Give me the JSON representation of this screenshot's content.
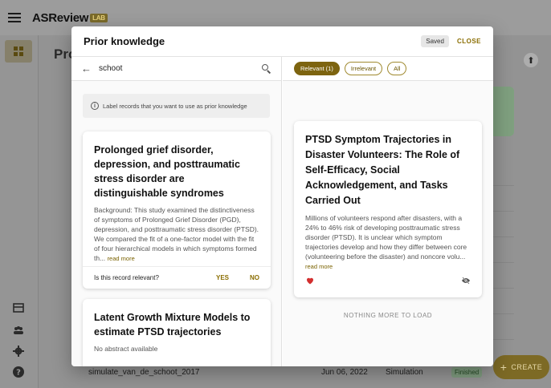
{
  "app": {
    "brand": "ASReview",
    "brand_tag": "LAB"
  },
  "background": {
    "page_title": "Pro",
    "row": {
      "name": "simulate_van_de_schoot_2017",
      "date": "Jun 06, 2022",
      "mode": "Simulation",
      "status": "Finished"
    },
    "fab_label": "CREATE"
  },
  "dialog": {
    "title": "Prior knowledge",
    "saved_label": "Saved",
    "close_label": "CLOSE",
    "search": {
      "query": "schoot"
    },
    "info_text": "Label records that you want to use as prior knowledge",
    "results": [
      {
        "title": "Prolonged grief disorder, depression, and posttraumatic stress disorder are distinguishable syndromes",
        "abstract": "Background: This study examined the distinctiveness of symptoms of Prolonged Grief Disorder (PGD), depression, and posttraumatic stress disorder (PTSD). We compared the fit of a one-factor model with the fit of four hierarchical models in which symptoms formed th...",
        "read_more": "read more",
        "question": "Is this record relevant?",
        "yes_label": "YES",
        "no_label": "NO"
      },
      {
        "title": "Latent Growth Mixture Models to estimate PTSD trajectories",
        "abstract": "No abstract available"
      }
    ],
    "filters": [
      {
        "label": "Relevant (1)",
        "active": true
      },
      {
        "label": "Irrelevant",
        "active": false
      },
      {
        "label": "All",
        "active": false
      }
    ],
    "labeled": {
      "title": "PTSD Symptom Trajectories in Disaster Volunteers: The Role of Self-Efficacy, Social Acknowledgement, and Tasks Carried Out",
      "abstract": "Millions of volunteers respond after disasters, with a 24% to 46% risk of developing posttraumatic stress disorder (PTSD). It is unclear which symptom trajectories develop and how they differ between core (volunteering before the disaster) and noncore volu...",
      "read_more": "read more"
    },
    "nothing_more": "NOTHING MORE TO LOAD"
  },
  "icons": {
    "menu": "menu-icon",
    "dashboard": "dashboard-icon",
    "search": "search-icon",
    "back": "back-arrow-icon",
    "info": "info-icon",
    "heart": "heart-icon",
    "hide": "visibility-off-icon",
    "upload": "upload-icon"
  },
  "colors": {
    "accent": "#8a6d00",
    "relevant_chip": "#7d6410",
    "heart": "#d32f2f"
  }
}
